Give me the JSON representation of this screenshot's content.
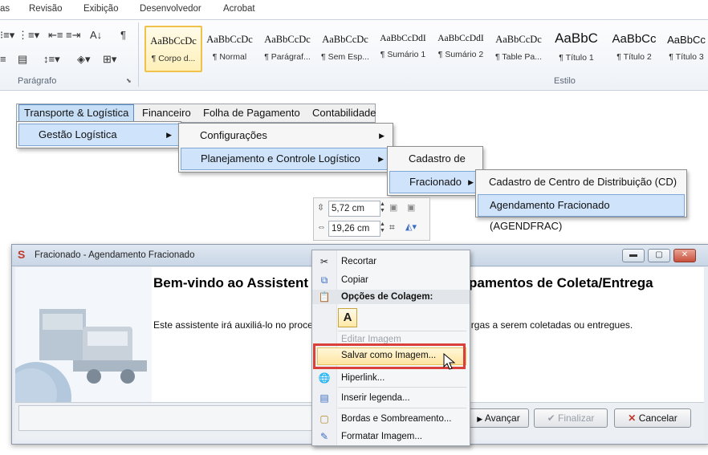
{
  "ribbon": {
    "tabs": [
      "as",
      "Revisão",
      "Exibição",
      "Desenvolvedor",
      "Acrobat"
    ],
    "paragraph_group_label": "Parágrafo",
    "styles_group_label": "Estilo",
    "styles": [
      {
        "sample": "AaBbCcDc",
        "name": "¶ Corpo d..."
      },
      {
        "sample": "AaBbCcDc",
        "name": "¶ Normal"
      },
      {
        "sample": "AaBbCcDc",
        "name": "¶ Parágraf..."
      },
      {
        "sample": "AaBbCcDc",
        "name": "¶ Sem Esp..."
      },
      {
        "sample": "AaBbCcDdI",
        "name": "¶ Sumário 1"
      },
      {
        "sample": "AaBbCcDdI",
        "name": "¶ Sumário 2"
      },
      {
        "sample": "AaBbCcDc",
        "name": "¶ Table Pa..."
      },
      {
        "sample": "AaBbC",
        "name": "¶ Título 1"
      },
      {
        "sample": "AaBbCc",
        "name": "¶ Título 2"
      },
      {
        "sample": "AaBbCc",
        "name": "¶ Título 3"
      }
    ]
  },
  "menubar": {
    "items": [
      "Transporte & Logística",
      "Financeiro",
      "Folha de Pagamento",
      "Contabilidade"
    ]
  },
  "cascade": {
    "level1": [
      "Gestão Logística"
    ],
    "level2": [
      "Configurações",
      "Planejamento e Controle Logístico"
    ],
    "level3": [
      "Cadastro de",
      "Fracionado"
    ],
    "level4": [
      "Cadastro de Centro de Distribuição (CD)",
      "Agendamento Fracionado (AGENDFRAC)"
    ]
  },
  "size_panel": {
    "height": "5,72 cm",
    "width": "19,26 cm"
  },
  "dialog": {
    "title": "Fracionado - Agendamento Fracionado",
    "heading_left": "Bem-vindo ao Assistent",
    "heading_right": "pamentos de Coleta/Entrega",
    "desc_left": "Este assistente irá auxiliá-lo no proces",
    "desc_right": "rgas a serem coletadas ou entregues.",
    "buttons": {
      "next": "Avançar",
      "finish": "Finalizar",
      "cancel": "Cancelar"
    }
  },
  "context_menu": {
    "cut": "Recortar",
    "copy": "Copiar",
    "paste_header": "Opções de Colagem:",
    "paste_option": "A",
    "edit_image": "Editar Imagem",
    "save_as_image": "Salvar como Imagem...",
    "hyperlink": "Hiperlink...",
    "insert_caption": "Inserir legenda...",
    "borders": "Bordas e Sombreamento...",
    "format_image": "Formatar Imagem..."
  },
  "colors": {
    "highlight_box": "#d9403a",
    "menu_highlight": "#cfe3fa",
    "selected_style_border": "#f0c14b"
  }
}
